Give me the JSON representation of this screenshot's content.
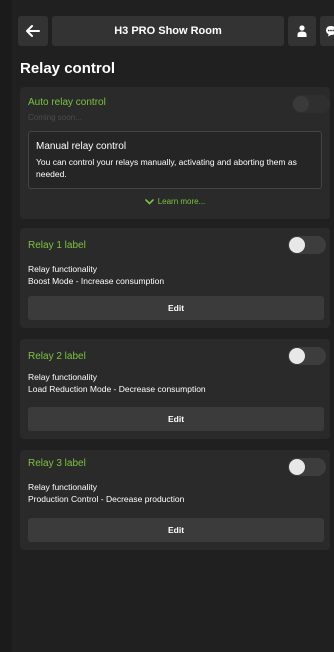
{
  "header": {
    "title": "H3 PRO Show Room",
    "back_icon": "arrow-left-icon",
    "user_icon": "user-icon",
    "chat_icon": "chat-icon"
  },
  "page_title": "Relay control",
  "auto": {
    "label": "Auto relay control",
    "subtitle": "Coming soon...",
    "info_title": "Manual relay control",
    "info_body": "You can control your relays manually, activating and aborting them as needed.",
    "learn_more": "Learn more..."
  },
  "relays": [
    {
      "label": "Relay 1 label",
      "func_title": "Relay functionality",
      "func_value": "Boost Mode - Increase consumption",
      "edit": "Edit"
    },
    {
      "label": "Relay 2 label",
      "func_title": "Relay functionality",
      "func_value": "Load Reduction Mode - Decrease consumption",
      "edit": "Edit"
    },
    {
      "label": "Relay 3 label",
      "func_title": "Relay functionality",
      "func_value": "Production Control - Decrease production",
      "edit": "Edit"
    }
  ],
  "colors": {
    "accent": "#7cc242",
    "background": "#202020",
    "card": "#2a2a2a"
  }
}
